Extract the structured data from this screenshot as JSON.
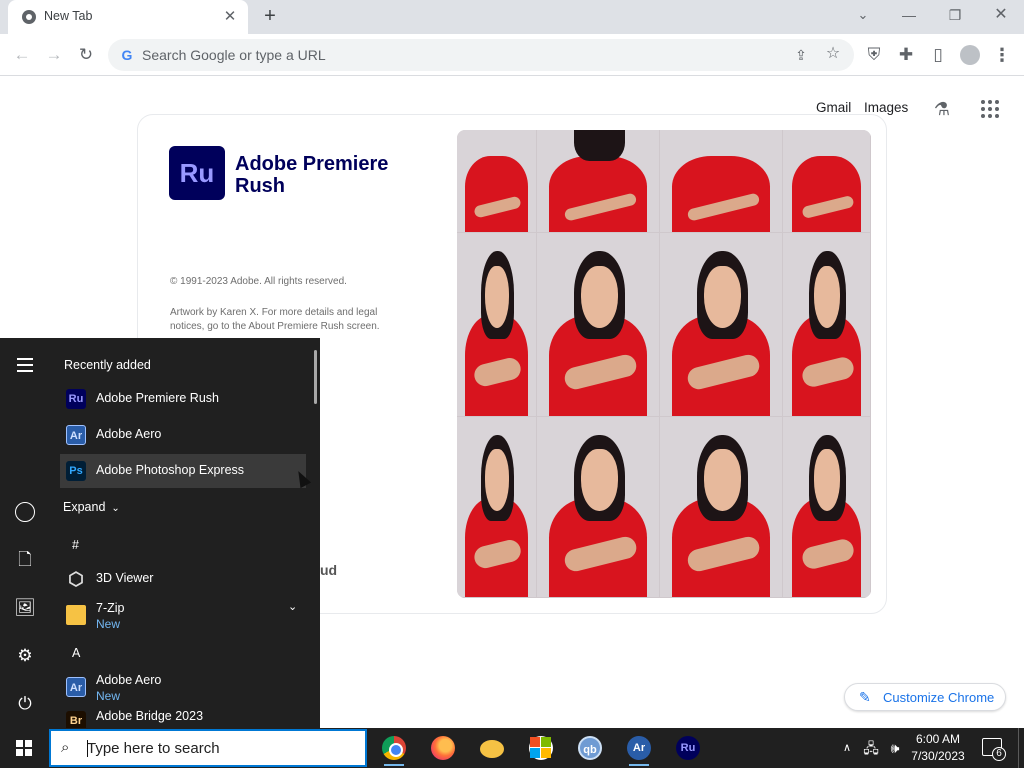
{
  "browser": {
    "tab": {
      "title": "New Tab",
      "close_glyph": "✕"
    },
    "new_tab_glyph": "+",
    "window_controls": {
      "tab_search": "⌄",
      "minimize": "—",
      "restore": "❐",
      "close": "✕"
    },
    "omnibox": {
      "placeholder": "Search Google or type a URL",
      "google_glyph": "G"
    },
    "toolbar_icons": [
      "back-arrow-icon",
      "forward-arrow-icon",
      "reload-icon",
      "share-icon",
      "star-icon",
      "shield-extension-icon",
      "puzzle-icon",
      "side-panel-icon",
      "profile-icon",
      "more-vert-icon"
    ],
    "nav_glyphs": {
      "back": "←",
      "forward": "→",
      "reload": "↻",
      "share": "⇪",
      "star": "☆",
      "shield": "⛨",
      "puzzle": "✚",
      "side_panel": "▯",
      "kebab": "⋮"
    }
  },
  "ntp": {
    "gmail": "Gmail",
    "images": "Images",
    "labs_glyph": "⚗",
    "customize_label": "Customize Chrome",
    "customize_glyph": "✎",
    "partial_text": "ud"
  },
  "splash": {
    "logo_text": "Ru",
    "title": "Adobe Premiere Rush",
    "copyright": "© 1991-2023 Adobe. All rights reserved.",
    "artwork": "Artwork by Karen X. For more details and legal notices, go to the About Premiere Rush screen."
  },
  "start_menu": {
    "recently_added_label": "Recently added",
    "recent_apps": [
      {
        "name": "Adobe Premiere Rush",
        "icon": "Ru"
      },
      {
        "name": "Adobe Aero",
        "icon": "Ar"
      },
      {
        "name": "Adobe Photoshop Express",
        "icon": "Ps"
      }
    ],
    "expand_label": "Expand",
    "expand_glyph": "⌄",
    "groups": [
      {
        "letter": "#"
      },
      {
        "letter": "A"
      }
    ],
    "apps": [
      {
        "name": "3D Viewer",
        "icon": "⬡"
      },
      {
        "name": "7-Zip",
        "badge": "New"
      },
      {
        "name": "Adobe Aero",
        "icon": "Ar",
        "badge": "New"
      },
      {
        "name": "Adobe Bridge 2023",
        "icon": "Br"
      }
    ],
    "rail_glyphs": {
      "docs": "🗋",
      "pics": "🖼",
      "settings": "⚙",
      "power": "⏻"
    },
    "zip_chevron": "⌄"
  },
  "taskbar": {
    "search_placeholder": "Type here to search",
    "search_glyph": "⌕",
    "apps": [
      "Google Chrome",
      "Firefox",
      "File Explorer",
      "Microsoft Store",
      "qBittorrent",
      "Adobe Aero",
      "Adobe Premiere Rush"
    ],
    "qb_text": "qb",
    "ar_text": "Ar",
    "ru_text": "Ru",
    "time": "6:00 AM",
    "date": "7/30/2023",
    "notification_count": "6",
    "tray_glyphs": {
      "up": "∧",
      "network": "🖧",
      "volume": "🕪"
    },
    "store_colors": [
      "#f25022",
      "#7fba00",
      "#00a4ef",
      "#ffb900"
    ]
  }
}
